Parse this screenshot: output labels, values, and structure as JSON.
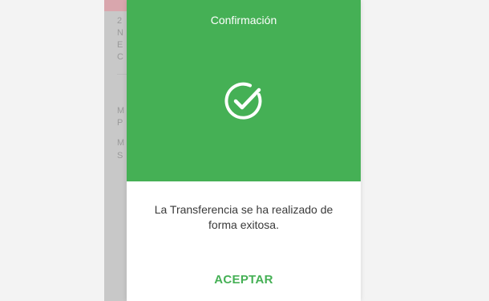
{
  "modal": {
    "title": "Confirmación",
    "message": "La Transferencia se ha realizado de forma exitosa.",
    "accept_label": "ACEPTAR",
    "icon": "check-circle-icon"
  },
  "colors": {
    "header_bg": "#45b055",
    "accent": "#45b055",
    "overlay": "#c8c8c8"
  }
}
